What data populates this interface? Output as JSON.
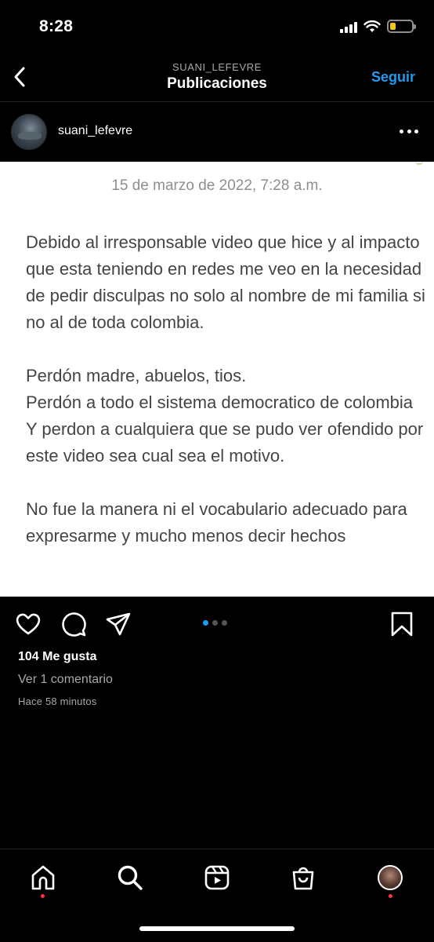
{
  "status_bar": {
    "time": "8:28",
    "battery_level": 0.25,
    "battery_color": "#f5c518"
  },
  "header": {
    "subtitle": "SUANI_LEFEVRE",
    "title": "Publicaciones",
    "follow_label": "Seguir",
    "accent": "#1f9bf0"
  },
  "post": {
    "username": "suani_lefevre",
    "date": "15 de marzo de 2022, 7:28 a.m.",
    "paragraphs": [
      "Debido al irresponsable video que hice y al impacto que esta teniendo en redes me veo en la necesidad de pedir disculpas  no solo al nombre de mi familia si no al de toda colombia.",
      "Perdón madre, abuelos, tios.\nPerdón a todo el sistema democratico de colombia\nY perdon a cualquiera que se pudo ver ofendido por este video sea cual sea el motivo.",
      "No fue la manera ni el vocabulario adecuado para expresarme y mucho menos decir hechos"
    ],
    "carousel": {
      "total": 3,
      "active": 1
    },
    "likes": "104 Me gusta",
    "comments": "Ver 1 comentario",
    "time_ago": "Hace 58 minutos"
  },
  "icons": {
    "back": "chevron-left-icon",
    "more": "more-horizontal-icon",
    "like": "heart-icon",
    "comment": "comment-icon",
    "share": "send-icon",
    "save": "bookmark-icon"
  },
  "bottom_nav": {
    "items": [
      {
        "icon": "home-icon",
        "notification": true
      },
      {
        "icon": "search-icon",
        "notification": false
      },
      {
        "icon": "reels-icon",
        "notification": false
      },
      {
        "icon": "shop-icon",
        "notification": false
      },
      {
        "icon": "profile-avatar",
        "notification": true
      }
    ],
    "notification_color": "#ff3040"
  }
}
